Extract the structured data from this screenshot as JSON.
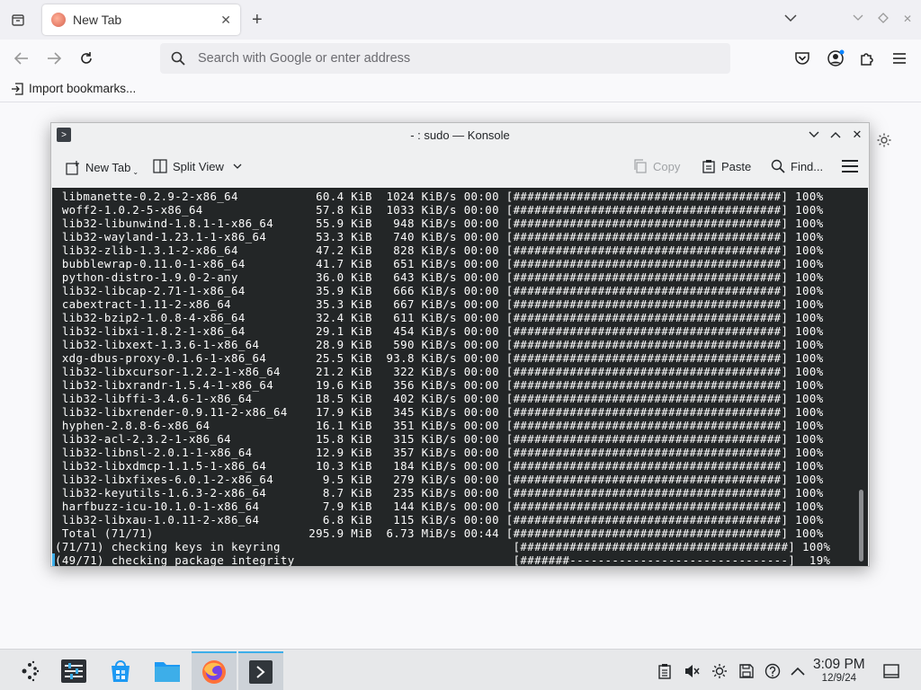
{
  "browser": {
    "tab": {
      "title": "New Tab"
    },
    "urlbar": {
      "placeholder": "Search with Google or enter address"
    },
    "bookmarks": {
      "import_label": "Import bookmarks..."
    }
  },
  "konsole": {
    "window_title": "- : sudo — Konsole",
    "toolbar": {
      "new_tab": "New Tab",
      "split_view": "Split View",
      "copy": "Copy",
      "paste": "Paste",
      "find": "Find..."
    },
    "terminal_lines": [
      " libmanette-0.2.9-2-x86_64           60.4 KiB  1024 KiB/s 00:00 [######################################] 100%",
      " woff2-1.0.2-5-x86_64                57.8 KiB  1033 KiB/s 00:00 [######################################] 100%",
      " lib32-libunwind-1.8.1-1-x86_64      55.9 KiB   948 KiB/s 00:00 [######################################] 100%",
      " lib32-wayland-1.23.1-1-x86_64       53.3 KiB   740 KiB/s 00:00 [######################################] 100%",
      " lib32-zlib-1.3.1-2-x86_64           47.2 KiB   828 KiB/s 00:00 [######################################] 100%",
      " bubblewrap-0.11.0-1-x86_64          41.7 KiB   651 KiB/s 00:00 [######################################] 100%",
      " python-distro-1.9.0-2-any           36.0 KiB   643 KiB/s 00:00 [######################################] 100%",
      " lib32-libcap-2.71-1-x86_64          35.9 KiB   666 KiB/s 00:00 [######################################] 100%",
      " cabextract-1.11-2-x86_64            35.3 KiB   667 KiB/s 00:00 [######################################] 100%",
      " lib32-bzip2-1.0.8-4-x86_64          32.4 KiB   611 KiB/s 00:00 [######################################] 100%",
      " lib32-libxi-1.8.2-1-x86_64          29.1 KiB   454 KiB/s 00:00 [######################################] 100%",
      " lib32-libxext-1.3.6-1-x86_64        28.9 KiB   590 KiB/s 00:00 [######################################] 100%",
      " xdg-dbus-proxy-0.1.6-1-x86_64       25.5 KiB  93.8 KiB/s 00:00 [######################################] 100%",
      " lib32-libxcursor-1.2.2-1-x86_64     21.2 KiB   322 KiB/s 00:00 [######################################] 100%",
      " lib32-libxrandr-1.5.4-1-x86_64      19.6 KiB   356 KiB/s 00:00 [######################################] 100%",
      " lib32-libffi-3.4.6-1-x86_64         18.5 KiB   402 KiB/s 00:00 [######################################] 100%",
      " lib32-libxrender-0.9.11-2-x86_64    17.9 KiB   345 KiB/s 00:00 [######################################] 100%",
      " hyphen-2.8.8-6-x86_64               16.1 KiB   351 KiB/s 00:00 [######################################] 100%",
      " lib32-acl-2.3.2-1-x86_64            15.8 KiB   315 KiB/s 00:00 [######################################] 100%",
      " lib32-libnsl-2.0.1-1-x86_64         12.9 KiB   357 KiB/s 00:00 [######################################] 100%",
      " lib32-libxdmcp-1.1.5-1-x86_64       10.3 KiB   184 KiB/s 00:00 [######################################] 100%",
      " lib32-libxfixes-6.0.1-2-x86_64       9.5 KiB   279 KiB/s 00:00 [######################################] 100%",
      " lib32-keyutils-1.6.3-2-x86_64        8.7 KiB   235 KiB/s 00:00 [######################################] 100%",
      " harfbuzz-icu-10.1.0-1-x86_64         7.9 KiB   144 KiB/s 00:00 [######################################] 100%",
      " lib32-libxau-1.0.11-2-x86_64         6.8 KiB   115 KiB/s 00:00 [######################################] 100%",
      " Total (71/71)                      295.9 MiB  6.73 MiB/s 00:44 [######################################] 100%",
      "(71/71) checking keys in keyring                                 [######################################] 100%",
      "(49/71) checking package integrity                               [#######-------------------------------]  19%"
    ]
  },
  "taskbar": {
    "clock_time": "3:09 PM",
    "clock_date": "12/9/24",
    "apps": [
      "application-launcher-icon",
      "system-settings-icon",
      "discover-store-icon",
      "file-manager-icon",
      "firefox-icon",
      "konsole-icon"
    ]
  },
  "colors": {
    "terminal_bg": "#232627",
    "terminal_fg": "#fcfcfc",
    "accent": "#3daee9"
  }
}
